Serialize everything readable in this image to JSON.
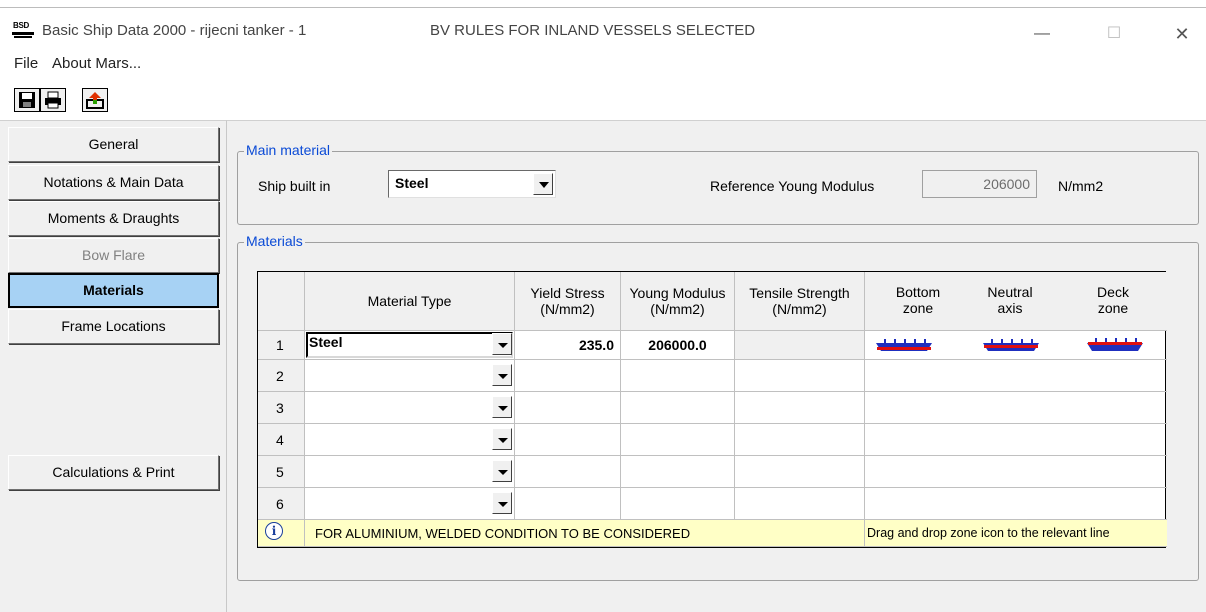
{
  "titlebar": {
    "title": "Basic Ship Data 2000 - rijecni tanker - 1",
    "rules_text": "BV RULES FOR INLAND VESSELS SELECTED",
    "icon_text": "BSD",
    "minimize_symbol": "—",
    "maximize_symbol": "☐",
    "close_symbol": "✕"
  },
  "menu": {
    "file": "File",
    "about": "About Mars..."
  },
  "toolbar": {
    "icons": [
      "save-icon",
      "print-icon",
      "export-icon"
    ]
  },
  "nav": {
    "items": [
      {
        "label": "General"
      },
      {
        "label": "Notations & Main Data"
      },
      {
        "label": "Moments & Draughts"
      },
      {
        "label": "Bow Flare",
        "disabled": true
      },
      {
        "label": "Materials",
        "active": true
      },
      {
        "label": "Frame Locations"
      }
    ],
    "calc_print": "Calculations & Print"
  },
  "main_material": {
    "legend": "Main material",
    "ship_built_label": "Ship built in",
    "ship_built_value": "Steel",
    "ref_young_label": "Reference Young Modulus",
    "ref_young_value": "206000",
    "unit": "N/mm2"
  },
  "materials": {
    "legend": "Materials",
    "headers": {
      "material_type": "Material Type",
      "yield_stress": "Yield Stress (N/mm2)",
      "young_modulus": "Young Modulus (N/mm2)",
      "tensile_strength": "Tensile Strength (N/mm2)",
      "bottom_zone": "Bottom zone",
      "neutral_axis": "Neutral axis",
      "deck_zone": "Deck zone"
    },
    "rows": [
      {
        "num": "1",
        "material": "Steel",
        "yield": "235.0",
        "young": "206000.0",
        "tensile": ""
      },
      {
        "num": "2",
        "material": "",
        "yield": "",
        "young": "",
        "tensile": ""
      },
      {
        "num": "3",
        "material": "",
        "yield": "",
        "young": "",
        "tensile": ""
      },
      {
        "num": "4",
        "material": "",
        "yield": "",
        "young": "",
        "tensile": ""
      },
      {
        "num": "5",
        "material": "",
        "yield": "",
        "young": "",
        "tensile": ""
      },
      {
        "num": "6",
        "material": "",
        "yield": "",
        "young": "",
        "tensile": ""
      }
    ],
    "info_text": "FOR ALUMINIUM, WELDED CONDITION TO BE CONSIDERED",
    "drag_hint": "Drag and drop zone icon to the relevant line",
    "zone_icons": [
      "bottom-zone-ship-icon",
      "neutral-axis-ship-icon",
      "deck-zone-ship-icon"
    ]
  },
  "colors": {
    "active_tab": "#a7d2f4",
    "legend_text": "#0a4ad6",
    "info_bg": "#ffffc6",
    "ship_blue": "#1f2fbf",
    "ship_red": "#e01010"
  }
}
